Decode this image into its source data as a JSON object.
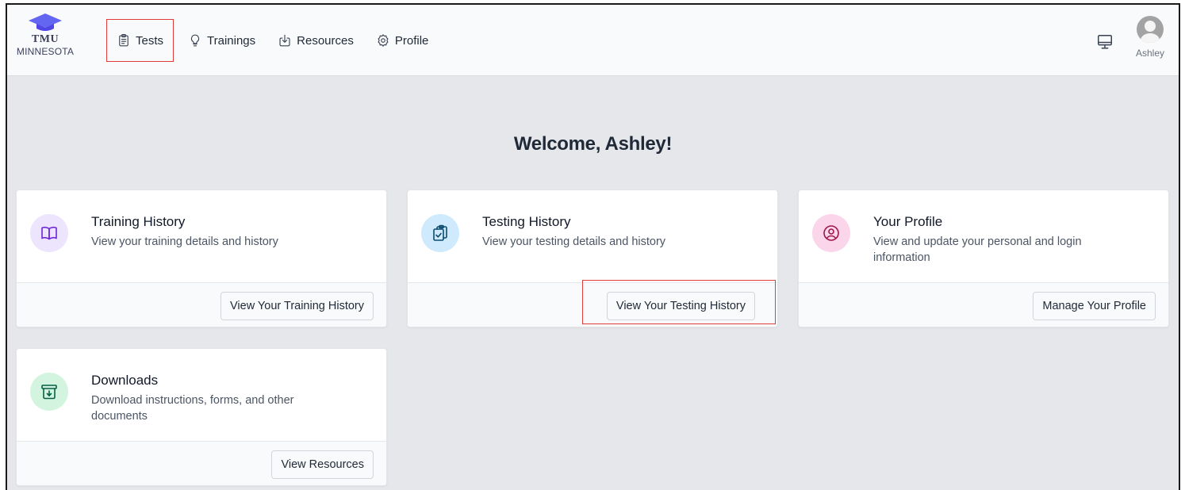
{
  "brand": {
    "line1": "TMU",
    "line2": "MINNESOTA"
  },
  "nav": {
    "tests": "Tests",
    "trainings": "Trainings",
    "resources": "Resources",
    "profile": "Profile"
  },
  "user": {
    "name": "Ashley"
  },
  "welcome": "Welcome, Ashley!",
  "cards": [
    {
      "title": "Training History",
      "description": "View your training details and history",
      "button": "View Your Training History",
      "icon": "book-icon",
      "color": "#ede4fe"
    },
    {
      "title": "Testing History",
      "description": "View your testing details and history",
      "button": "View Your Testing History",
      "icon": "clipboard-check-icon",
      "color": "#cfeafc"
    },
    {
      "title": "Your Profile",
      "description": "View and update your personal and login information",
      "button": "Manage Your Profile",
      "icon": "user-circle-icon",
      "color": "#fbd6ea"
    },
    {
      "title": "Downloads",
      "description": "Download instructions, forms, and other documents",
      "button": "View Resources",
      "icon": "archive-download-icon",
      "color": "#d3f5df"
    }
  ],
  "highlight_color": "#e03c3c"
}
